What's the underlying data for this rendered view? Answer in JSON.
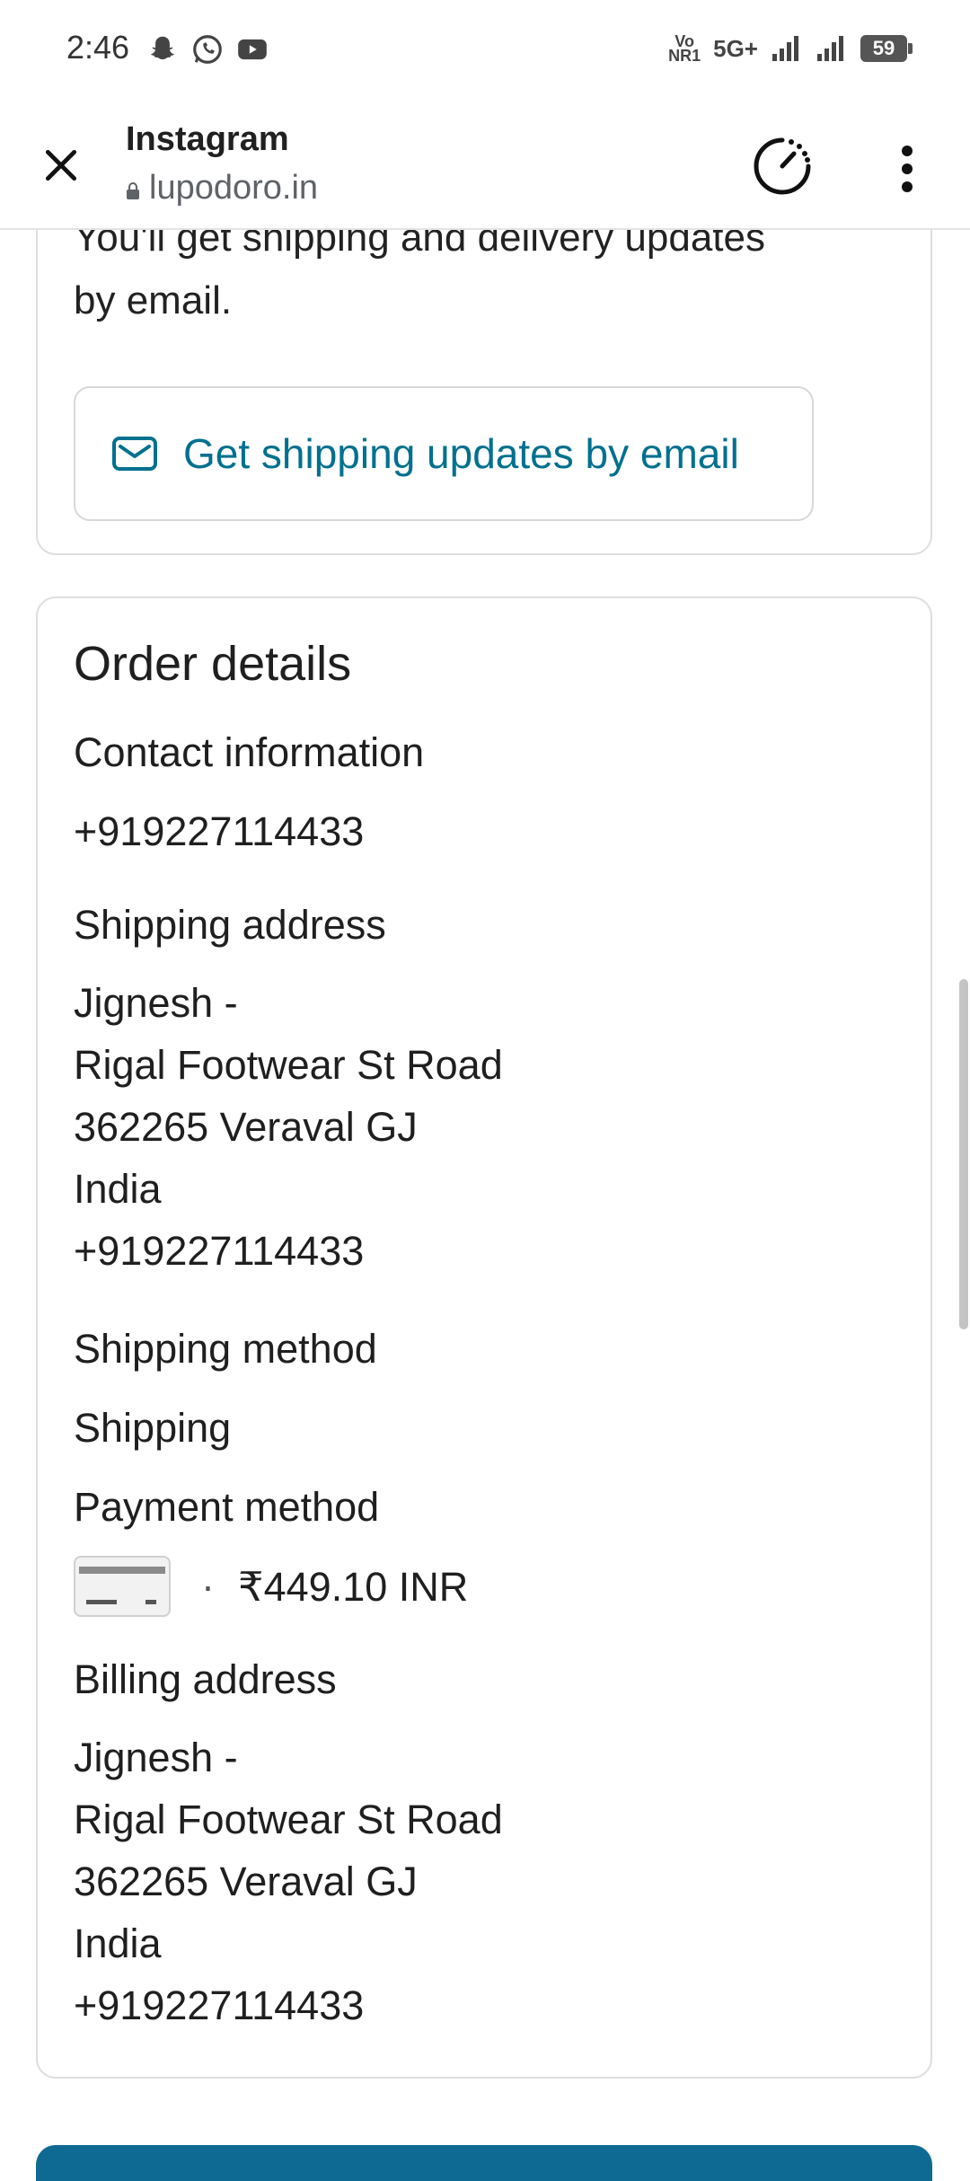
{
  "status_bar": {
    "time": "2:46",
    "network_label_top": "Vo",
    "network_label_bottom": "NR1",
    "network_type": "5G+",
    "battery": "59",
    "notification_icons": [
      "snapchat-icon",
      "whatsapp-icon",
      "youtube-icon"
    ]
  },
  "toolbar": {
    "title": "Instagram",
    "url": "lupodoro.in",
    "icons": [
      "close-icon",
      "lock-icon",
      "timer-icon",
      "more-vert-icon"
    ]
  },
  "shipping_updates": {
    "partial_line": "You'll get shipping and delivery updates",
    "text_end": "by email.",
    "button_label": "Get shipping updates by email",
    "accent_color": "#00708f"
  },
  "order_details": {
    "title": "Order details",
    "contact_label": "Contact information",
    "contact_value": "+919227114433",
    "shipping_address_label": "Shipping address",
    "shipping_address": [
      "Jignesh -",
      "Rigal Footwear St Road",
      "362265 Veraval GJ",
      "India",
      "+919227114433"
    ],
    "shipping_method_label": "Shipping method",
    "shipping_method_value": "Shipping",
    "payment_method_label": "Payment method",
    "payment_separator": "·",
    "payment_amount": "₹449.10 INR",
    "billing_address_label": "Billing address",
    "billing_address": [
      "Jignesh -",
      "Rigal Footwear St Road",
      "362265 Veraval GJ",
      "India",
      "+919227114433"
    ]
  }
}
